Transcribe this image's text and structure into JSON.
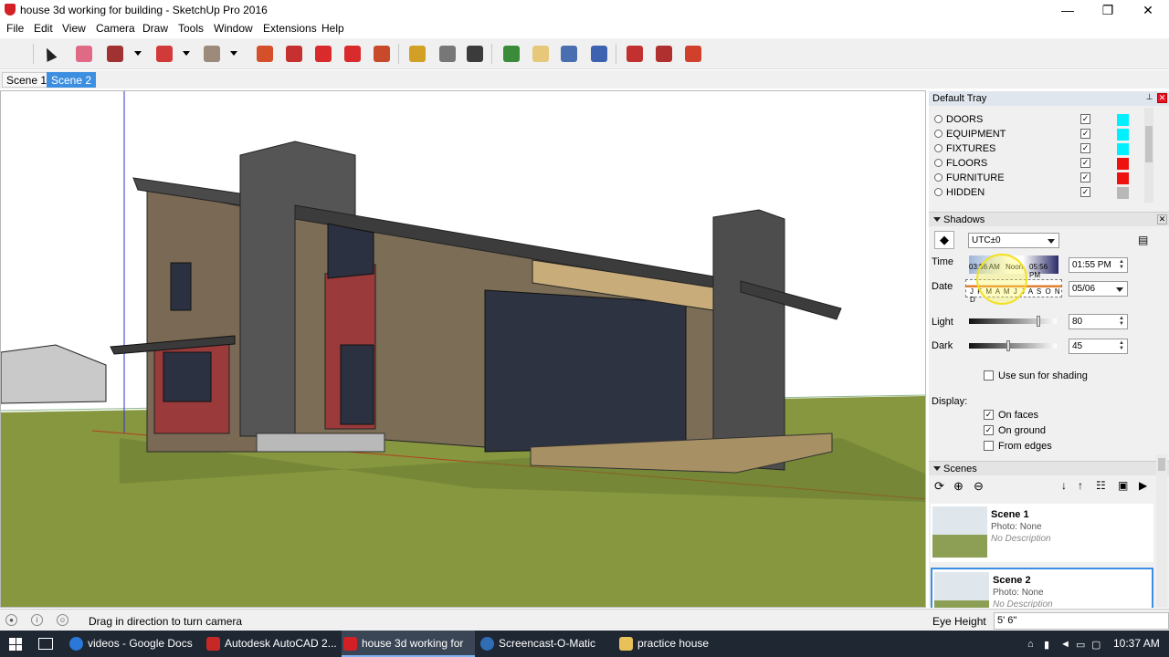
{
  "window": {
    "title": "house 3d working for building - SketchUp Pro 2016",
    "min_glyph": "—",
    "max_glyph": "❐",
    "close_glyph": "✕"
  },
  "menu": [
    "File",
    "Edit",
    "View",
    "Camera",
    "Draw",
    "Tools",
    "Window",
    "Extensions",
    "Help"
  ],
  "toolbar": {
    "tools": [
      {
        "name": "select",
        "color": "#333333"
      },
      {
        "name": "eraser",
        "color": "#e06a86"
      },
      {
        "name": "pencil",
        "color": "#a13232"
      },
      {
        "name": "arc",
        "color": "#d23a3a"
      },
      {
        "name": "rectangle",
        "color": "#9c8a7a"
      },
      {
        "name": "push-pull",
        "color": "#d54f2a"
      },
      {
        "name": "follow-me",
        "color": "#c63030"
      },
      {
        "name": "move",
        "color": "#d92b2b"
      },
      {
        "name": "rotate",
        "color": "#d92b2b"
      },
      {
        "name": "scale",
        "color": "#c94a2a"
      },
      {
        "name": "tape-measure",
        "color": "#d2a024"
      },
      {
        "name": "text",
        "color": "#777777"
      },
      {
        "name": "paint-bucket",
        "color": "#3b3b3b"
      },
      {
        "name": "orbit",
        "color": "#3a8c3a"
      },
      {
        "name": "pan",
        "color": "#e7c77a"
      },
      {
        "name": "zoom",
        "color": "#4a6fb0"
      },
      {
        "name": "zoom-extents",
        "color": "#3d62b0"
      },
      {
        "name": "warehouse",
        "color": "#c23030"
      },
      {
        "name": "extension-warehouse",
        "color": "#b03030"
      },
      {
        "name": "share-model",
        "color": "#d0402a"
      }
    ]
  },
  "scene_tabs": [
    {
      "label": "Scene 1",
      "active": false
    },
    {
      "label": "Scene 2",
      "active": true
    }
  ],
  "tray": {
    "title": "Default Tray",
    "tags": [
      {
        "name": "DOORS",
        "visible": true,
        "color": "#00f0ff"
      },
      {
        "name": "EQUIPMENT",
        "visible": true,
        "color": "#00f0ff"
      },
      {
        "name": "FIXTURES",
        "visible": true,
        "color": "#00f0ff"
      },
      {
        "name": "FLOORS",
        "visible": true,
        "color": "#ee1111"
      },
      {
        "name": "FURNITURE",
        "visible": true,
        "color": "#ee1111"
      },
      {
        "name": "HIDDEN",
        "visible": true,
        "color": "#b8b8b8"
      }
    ],
    "shadows": {
      "title": "Shadows",
      "timezone": "UTC±0",
      "time_label": "Time",
      "date_label": "Date",
      "sunrise": "03:56 AM",
      "noon": "Noon",
      "sunset": "05:56 PM",
      "time_value": "01:55 PM",
      "months": "J F M A M J J A S O N D",
      "date_value": "05/06",
      "light_label": "Light",
      "light_value": "80",
      "light_level": 0.8,
      "dark_label": "Dark",
      "dark_value": "45",
      "dark_level": 0.45,
      "use_sun_label": "Use sun for shading",
      "use_sun": false,
      "display_label": "Display:",
      "on_faces_label": "On faces",
      "on_faces": true,
      "on_ground_label": "On ground",
      "on_ground": true,
      "from_edges_label": "From edges",
      "from_edges": false
    },
    "scenes": {
      "title": "Scenes",
      "items": [
        {
          "name": "Scene 1",
          "photo": "Photo: None",
          "description": "No Description",
          "selected": false
        },
        {
          "name": "Scene 2",
          "photo": "Photo: None",
          "description": "No Description",
          "selected": true
        }
      ]
    }
  },
  "status": {
    "message": "Drag in direction to turn camera",
    "eye_height_label": "Eye Height",
    "eye_height_value": "5' 6\""
  },
  "taskbar": {
    "items": [
      {
        "label": "videos - Google Docs ...",
        "color": "#2a78d8",
        "active": false
      },
      {
        "label": "Autodesk AutoCAD 2...",
        "color": "#c62828",
        "active": false
      },
      {
        "label": "house 3d working for ...",
        "color": "#d32027",
        "active": true
      },
      {
        "label": "Screencast-O-Matic",
        "color": "#2f6db5",
        "active": false
      },
      {
        "label": "practice house",
        "color": "#e8c15a",
        "active": false
      }
    ],
    "clock": "10:37 AM"
  }
}
